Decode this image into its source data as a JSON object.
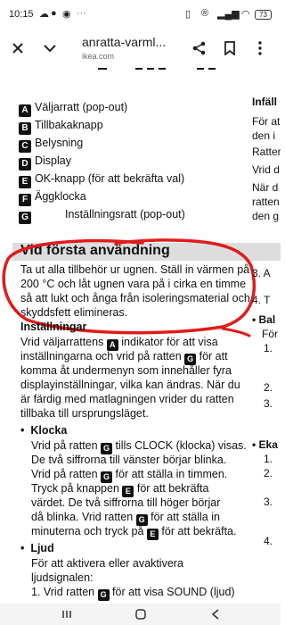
{
  "status": {
    "time": "10:15",
    "battery": "73"
  },
  "toolbar": {
    "title": "anratta-varml...",
    "domain": "ikea.com"
  },
  "legend": [
    {
      "label": "A",
      "text": "Väljarratt (pop-out)"
    },
    {
      "label": "B",
      "text": "Tillbakaknapp"
    },
    {
      "label": "C",
      "text": "Belysning"
    },
    {
      "label": "D",
      "text": "Display"
    },
    {
      "label": "E",
      "text": "OK-knapp (för att bekräfta val)"
    },
    {
      "label": "F",
      "text": "Äggklocka"
    },
    {
      "label": "G",
      "text": "Inställningsratt (pop-out)"
    }
  ],
  "section": {
    "heading": "Vid första användning",
    "intro": [
      "Ta ut alla tillbehör ur ugnen. Ställ in värmen på",
      "200 °C och låt ugnen vara på i cirka en timme",
      "så att lukt och ånga från isoleringsmaterial och",
      "skyddsfett elimineras."
    ],
    "settings_head": "Inställningar",
    "settings": [
      {
        "pre": "Vrid väljarrattens ",
        "lbl": "A",
        "post": " indikator för att visa"
      },
      {
        "pre": "inställningarna och vrid på ratten ",
        "lbl": "G",
        "post": " för att"
      },
      {
        "pre": "komma åt undermenyn som innehåller fyra",
        "lbl": "",
        "post": ""
      },
      {
        "pre": "displayinställningar, vilka kan ändras. När du",
        "lbl": "",
        "post": ""
      },
      {
        "pre": "är färdig med matlagningen vrider du ratten",
        "lbl": "",
        "post": ""
      },
      {
        "pre": "tillbaka till ursprungsläget.",
        "lbl": "",
        "post": ""
      }
    ],
    "clock_head": "Klocka",
    "clock": [
      {
        "pre": "Vrid på ratten ",
        "lbl": "G",
        "post": " tills CLOCK (klocka) visas."
      },
      {
        "pre": "De två siffrorna till vänster börjar blinka.",
        "lbl": "",
        "post": ""
      },
      {
        "pre": "Vrid på ratten ",
        "lbl": "G",
        "post": " för att ställa in timmen."
      },
      {
        "pre": "Tryck på knappen ",
        "lbl": "E",
        "post": " för att bekräfta"
      },
      {
        "pre": "värdet. De två siffrorna till höger börjar",
        "lbl": "",
        "post": ""
      },
      {
        "pre": "då blinka. Vrid ratten ",
        "lbl": "G",
        "post": " för att ställa in"
      },
      {
        "pre": "minuterna och tryck på ",
        "lbl": "E",
        "post": " för att bekräfta."
      }
    ],
    "sound_head": "Ljud",
    "sound": [
      {
        "pre": "För att aktivera eller avaktivera",
        "lbl": "",
        "post": ""
      },
      {
        "pre": "ljudsignalen:",
        "lbl": "",
        "post": ""
      },
      {
        "pre": "1.  Vrid ratten ",
        "lbl": "G",
        "post": " för att visa SOUND (ljud)"
      }
    ]
  },
  "right_column": [
    "Infäll",
    "För at",
    "den i",
    "Ratter",
    "Vrid d",
    "När d",
    "ratten",
    "den g",
    "3.  A",
    "4.  T",
    "• Bal",
    "För",
    "1.",
    "2.",
    "3.",
    "• Eka",
    "1.",
    "2.",
    "3.",
    "4."
  ],
  "annotation_color": "#e11b1b"
}
